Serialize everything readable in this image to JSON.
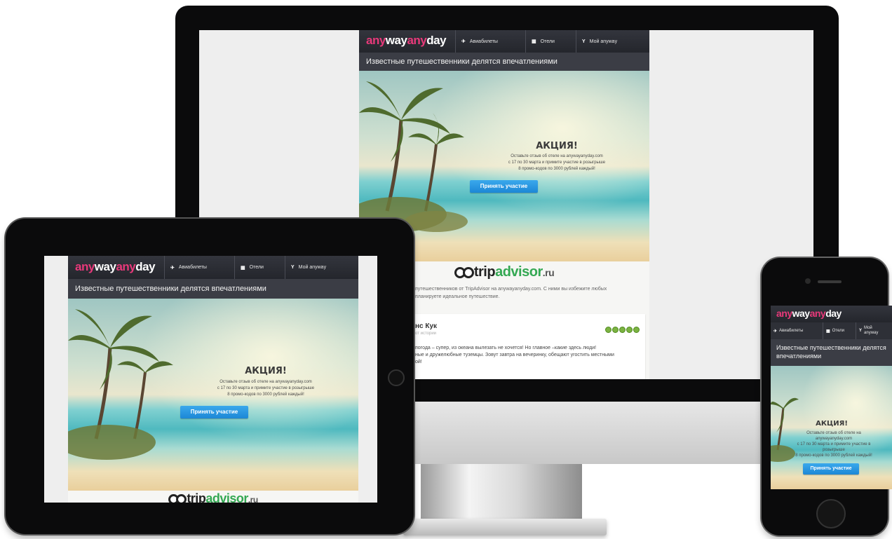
{
  "brand": {
    "part1": "any",
    "part2": "way",
    "part3": "any",
    "part4": "day",
    "pink": "#e8397a"
  },
  "nav": {
    "flights": {
      "label": "Авиабилеты",
      "icon": "plane-icon"
    },
    "hotels": {
      "label": "Отели",
      "icon": "building-icon"
    },
    "account": {
      "label": "Мой anyway",
      "icon": "trophy-icon"
    }
  },
  "headline": "Известные путешественники делятся впечатлениями",
  "promo": {
    "title": "АКЦИЯ!",
    "line1": "Оставьте отзыв об отеле на anywayanyday.com",
    "line2": "с 17 по 30 марта и примите участие в розыгрыше",
    "line3": "8 промо-кодов по 3000 рублей каждый!",
    "button": "Принять участие"
  },
  "phone_promo": {
    "line1": "Оставьте отзыв об отеле на",
    "line2": "anywayanyday.com",
    "line3": "с 17 по 30 марта и примите участие в",
    "line4": "розыгрыше",
    "line5": "8 промо-кодов по 3000 рублей каждый!",
    "nav_account": "Мой anyway"
  },
  "tripadvisor": {
    "trip": "trip",
    "advisor": "advisor",
    "ru": ".ru"
  },
  "intro": {
    "line1": "путешественников от TripAdvisor на anywayanyday.com. С ними вы избежите любых",
    "line2": "планируете идеальное путешествие."
  },
  "review": {
    "author": "нс Кук",
    "sub": "от истории",
    "line1": "погода – супер, из океана вылезать не хочется! Но главное –какие здесь люди!",
    "line2": "ные и дружелюбные туземцы. Зовут завтра на вечеринку, обещают угостить местными",
    "line3": "ой!",
    "rating": 5
  },
  "colors": {
    "bezel": "#0b0b0c",
    "nav": "#2a2c33",
    "button": "#1c87d6",
    "accent": "#e8397a"
  }
}
